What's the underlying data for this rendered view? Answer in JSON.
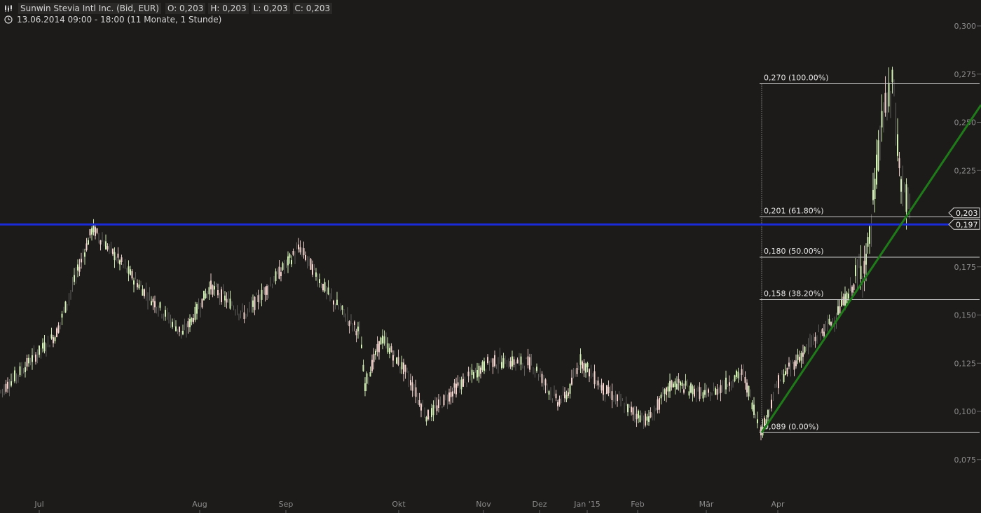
{
  "header": {
    "instrument": "Sunwin Stevia Intl Inc. (Bid, EUR)",
    "open": "O: 0,203",
    "high": "H: 0,203",
    "low": "L: 0,203",
    "close": "C: 0,203",
    "range": "13.06.2014 09:00 - 18:00 (11 Monate, 1 Stunde)",
    "icons": [
      "candlestick-chart-icon",
      "clock-icon"
    ]
  },
  "colors": {
    "background": "#1c1b19",
    "text": "#d6d6d6",
    "axis_text": "#8c8c8c",
    "up_candle": "#d4f2b8",
    "down_candle": "#f5d4d0",
    "doji": "#8a8a8a",
    "support_line": "#1a2bd9",
    "trend_line": "#1f7a19",
    "fib_line": "#c8c8c8"
  },
  "chart_data": {
    "type": "candlestick",
    "title": "Sunwin Stevia Intl Inc. (Bid, EUR)",
    "interval": "1 Stunde",
    "x_labels": [
      "Jul",
      "Aug",
      "Sep",
      "Okt",
      "Nov",
      "Dez",
      "Jan '15",
      "Feb",
      "Mär",
      "Apr"
    ],
    "y_ticks": [
      "0,300",
      "0,275",
      "0,250",
      "0,225",
      "0,175",
      "0,150",
      "0,125",
      "0,100",
      "0,075"
    ],
    "y_tick_values": [
      0.3,
      0.275,
      0.25,
      0.225,
      0.175,
      0.15,
      0.125,
      0.1,
      0.075
    ],
    "ylim": [
      0.075,
      0.3
    ],
    "grid": false,
    "last_price_label": "0,203",
    "last_price": 0.203,
    "horizontal_line": {
      "value": 0.197,
      "label": "0,197"
    },
    "fibonacci": {
      "start_month": "Mär",
      "levels": [
        {
          "value": 0.27,
          "label": "0,270 (100.00%)"
        },
        {
          "value": 0.201,
          "label": "0,201 (61.80%)"
        },
        {
          "value": 0.18,
          "label": "0,180 (50.00%)"
        },
        {
          "value": 0.158,
          "label": "0,158 (38.20%)"
        },
        {
          "value": 0.089,
          "label": "0,089 (0.00%)"
        }
      ]
    },
    "trend_line": {
      "from": {
        "month": "Mär",
        "value": 0.089
      },
      "to_value_at_right_edge": 0.259
    },
    "price_path": [
      {
        "month": "Jun",
        "close": 0.11
      },
      {
        "month": "Jul",
        "close": 0.14
      },
      {
        "month": "Jul",
        "close": 0.195
      },
      {
        "month": "Aug",
        "close": 0.165
      },
      {
        "month": "Aug",
        "close": 0.14
      },
      {
        "month": "Aug",
        "close": 0.165
      },
      {
        "month": "Sep",
        "close": 0.15
      },
      {
        "month": "Sep",
        "close": 0.185
      },
      {
        "month": "Sep",
        "close": 0.16
      },
      {
        "month": "Okt",
        "close": 0.14
      },
      {
        "month": "Okt",
        "close": 0.113
      },
      {
        "month": "Okt",
        "close": 0.138
      },
      {
        "month": "Okt",
        "close": 0.12
      },
      {
        "month": "Okt",
        "close": 0.097
      },
      {
        "month": "Nov",
        "close": 0.112
      },
      {
        "month": "Nov",
        "close": 0.126
      },
      {
        "month": "Dez",
        "close": 0.125
      },
      {
        "month": "Dez",
        "close": 0.105
      },
      {
        "month": "Jan '15",
        "close": 0.11
      },
      {
        "month": "Jan '15",
        "close": 0.127
      },
      {
        "month": "Jan '15",
        "close": 0.112
      },
      {
        "month": "Feb",
        "close": 0.102
      },
      {
        "month": "Feb",
        "close": 0.095
      },
      {
        "month": "Feb",
        "close": 0.115
      },
      {
        "month": "Mär",
        "close": 0.108
      },
      {
        "month": "Mär",
        "close": 0.12
      },
      {
        "month": "Mär",
        "close": 0.089
      },
      {
        "month": "Apr",
        "close": 0.115
      },
      {
        "month": "Apr",
        "close": 0.13
      },
      {
        "month": "Apr",
        "close": 0.148
      },
      {
        "month": "Apr",
        "close": 0.17
      },
      {
        "month": "Apr",
        "close": 0.185
      },
      {
        "month": "Apr",
        "close": 0.25
      },
      {
        "month": "Apr",
        "close": 0.27
      },
      {
        "month": "Apr",
        "close": 0.22
      },
      {
        "month": "Apr",
        "close": 0.203
      }
    ]
  }
}
